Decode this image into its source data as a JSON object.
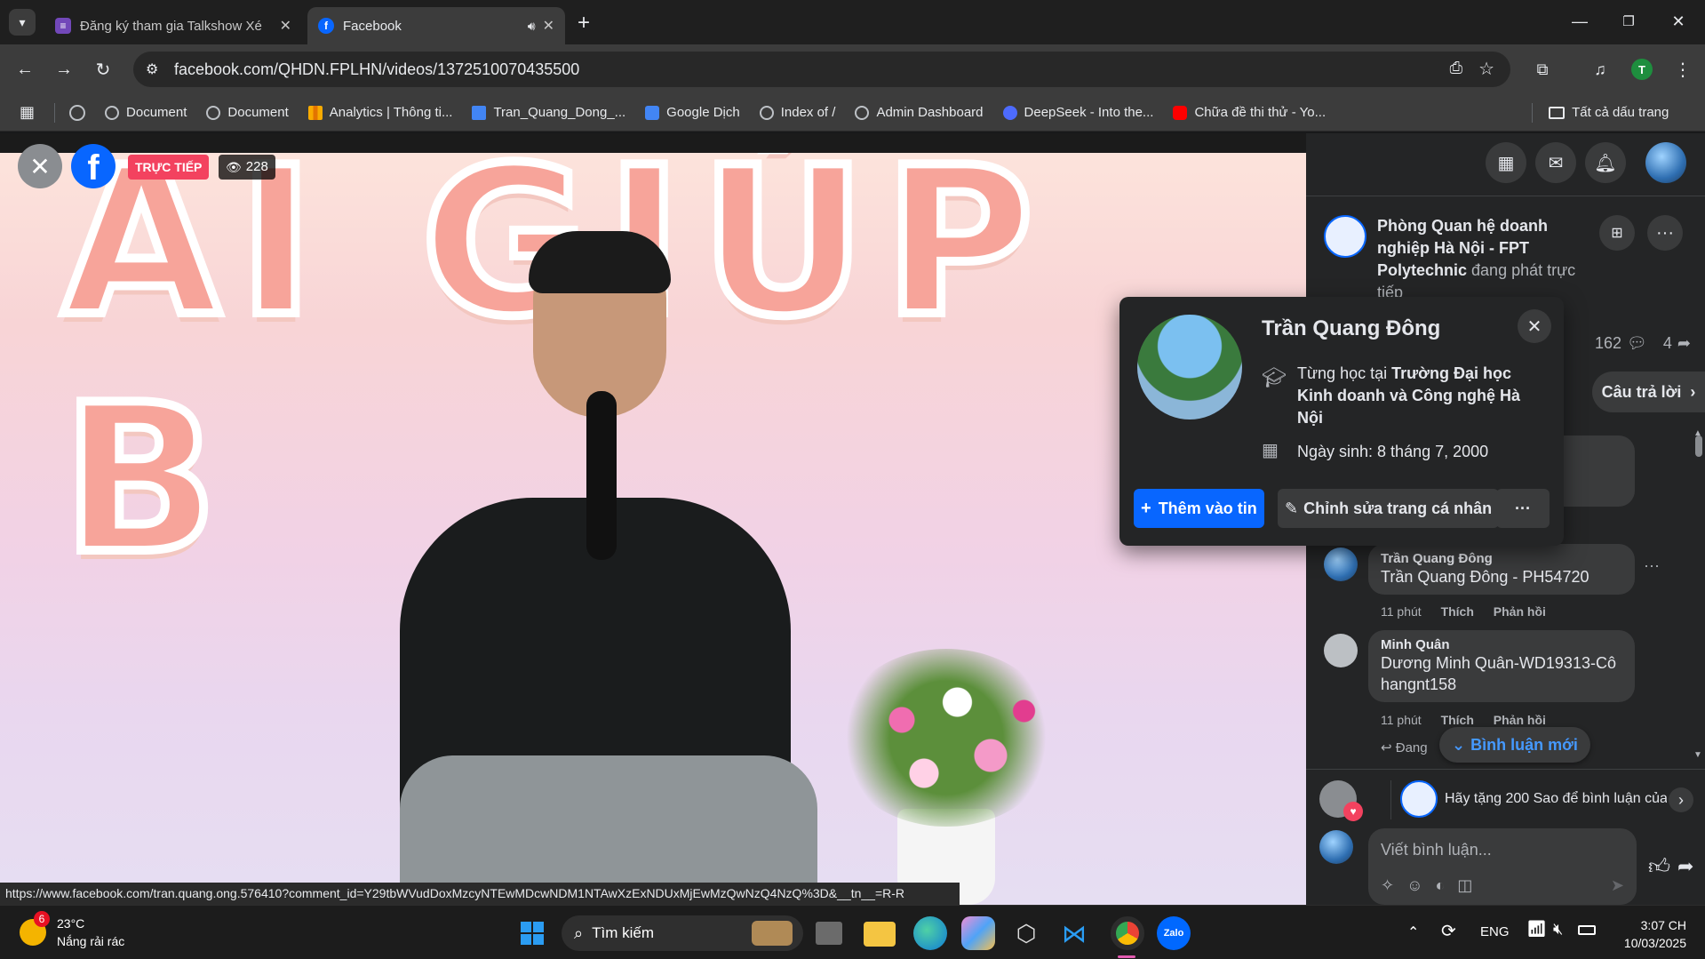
{
  "browser": {
    "tabs": [
      {
        "title": "Đăng ký tham gia Talkshow Xé ",
        "icon": "forms-icon",
        "close": "✕"
      },
      {
        "title": "Facebook",
        "icon": "facebook-icon",
        "close": "✕"
      }
    ],
    "new_tab": "+",
    "url": "facebook.com/QHDN.FPLHN/videos/1372510070435500",
    "bookmarks": [
      {
        "label": "Document",
        "icon": "globe-icon"
      },
      {
        "label": "Document",
        "icon": "globe-icon"
      },
      {
        "label": "Analytics | Thông ti...",
        "icon": "analytics-icon"
      },
      {
        "label": "Tran_Quang_Dong_...",
        "icon": "docs-icon"
      },
      {
        "label": "Google Dịch",
        "icon": "translate-icon"
      },
      {
        "label": "Index of /",
        "icon": "globe-icon"
      },
      {
        "label": "Admin Dashboard",
        "icon": "globe-icon"
      },
      {
        "label": "DeepSeek - Into the...",
        "icon": "deepseek-icon"
      },
      {
        "label": "Chữa đề thi thử - Yo...",
        "icon": "youtube-icon"
      }
    ],
    "all_bookmarks": "Tất cả dấu trang",
    "profile_initial": "T",
    "status_url": "https://www.facebook.com/tran.quang.ong.576410?comment_id=Y29tbWVudDoxMzcyNTEwMDcwNDM1NTAwXzExNDUxMjEwMzQwNzQ4NzQ%3D&__tn__=R-R"
  },
  "video": {
    "live_badge": "TRỰC TIẾP",
    "viewers": "228",
    "banner_text": "AI GIÚP B"
  },
  "panel": {
    "page_name": "Phòng Quan hệ doanh nghiệp Hà Nội - FPT Polytechnic",
    "live_suffix": " đang phát trực tiếp",
    "comments_count": "162",
    "shares_count": "4",
    "answer_button": "Câu trả lời",
    "comments": [
      {
        "name": "Trần Quang Đông",
        "text": "Trần Quang Đông - PH54720",
        "time": "11 phút",
        "like": "Thích",
        "reply": "Phản hồi"
      },
      {
        "name": "Minh Quân",
        "text": "Dương Minh Quân-WD19313-Cô hangnt158",
        "time": "11 phút",
        "like": "Thích",
        "reply": "Phản hồi"
      }
    ],
    "reply_partial": "Đang",
    "new_comments": "Bình luận mới",
    "stars_prompt": "Hãy tặng 200 Sao để bình luận của",
    "comment_placeholder": "Viết bình luận..."
  },
  "popup": {
    "name": "Trần Quang Đông",
    "study_prefix": "Từng học tại ",
    "study_place": "Trường Đại học Kinh doanh và Công nghệ Hà Nội",
    "birthday": "Ngày sinh: 8 tháng 7, 2000",
    "add_story": "Thêm vào tin",
    "edit_profile": "Chỉnh sửa trang cá nhân",
    "more": "···"
  },
  "taskbar": {
    "weather_temp": "23°C",
    "weather_desc": "Nắng rải rác",
    "weather_badge": "6",
    "search": "Tìm kiếm",
    "language": "ENG",
    "time": "3:07 CH",
    "date": "10/03/2025"
  },
  "colors": {
    "facebook_blue": "#0866ff",
    "live_red": "#f3425f",
    "panel_bg": "#242526",
    "bubble_bg": "#3a3b3c"
  }
}
